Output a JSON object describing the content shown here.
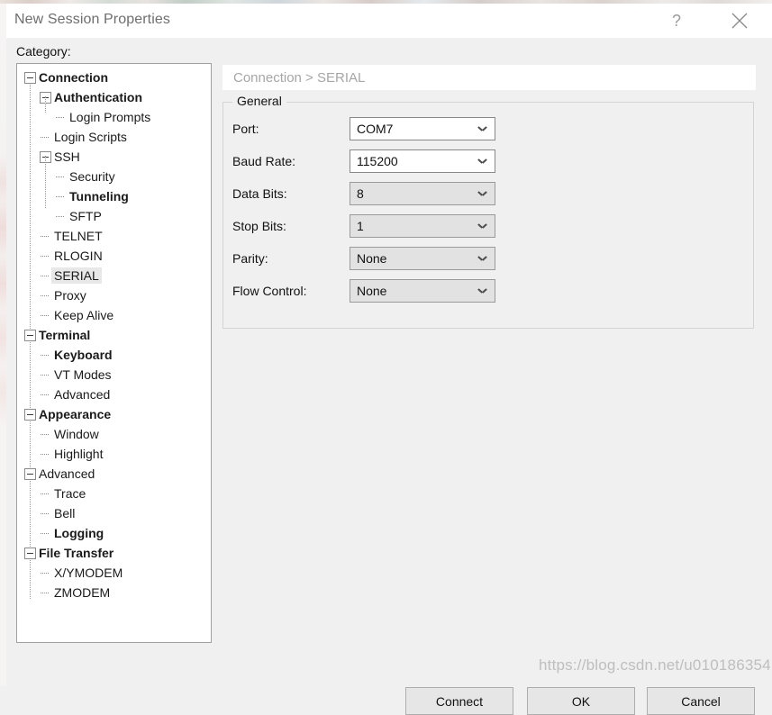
{
  "window": {
    "title": "New Session Properties",
    "help_icon": "question-mark-icon",
    "close_icon": "close-icon"
  },
  "sidebar": {
    "label": "Category:",
    "selected": "SERIAL",
    "items": [
      {
        "label": "Connection",
        "level": 0,
        "bold": true,
        "expander": "minus"
      },
      {
        "label": "Authentication",
        "level": 1,
        "bold": true,
        "expander": "minus"
      },
      {
        "label": "Login Prompts",
        "level": 2,
        "bold": false,
        "expander": "leaf-last"
      },
      {
        "label": "Login Scripts",
        "level": 1,
        "bold": false,
        "expander": "leaf"
      },
      {
        "label": "SSH",
        "level": 1,
        "bold": false,
        "expander": "minus"
      },
      {
        "label": "Security",
        "level": 2,
        "bold": false,
        "expander": "leaf"
      },
      {
        "label": "Tunneling",
        "level": 2,
        "bold": true,
        "expander": "leaf"
      },
      {
        "label": "SFTP",
        "level": 2,
        "bold": false,
        "expander": "leaf-last"
      },
      {
        "label": "TELNET",
        "level": 1,
        "bold": false,
        "expander": "leaf"
      },
      {
        "label": "RLOGIN",
        "level": 1,
        "bold": false,
        "expander": "leaf"
      },
      {
        "label": "SERIAL",
        "level": 1,
        "bold": false,
        "expander": "leaf"
      },
      {
        "label": "Proxy",
        "level": 1,
        "bold": false,
        "expander": "leaf"
      },
      {
        "label": "Keep Alive",
        "level": 1,
        "bold": false,
        "expander": "leaf-last"
      },
      {
        "label": "Terminal",
        "level": 0,
        "bold": true,
        "expander": "minus"
      },
      {
        "label": "Keyboard",
        "level": 1,
        "bold": true,
        "expander": "leaf"
      },
      {
        "label": "VT Modes",
        "level": 1,
        "bold": false,
        "expander": "leaf"
      },
      {
        "label": "Advanced",
        "level": 1,
        "bold": false,
        "expander": "leaf-last"
      },
      {
        "label": "Appearance",
        "level": 0,
        "bold": true,
        "expander": "minus"
      },
      {
        "label": "Window",
        "level": 1,
        "bold": false,
        "expander": "leaf"
      },
      {
        "label": "Highlight",
        "level": 1,
        "bold": false,
        "expander": "leaf-last"
      },
      {
        "label": "Advanced",
        "level": 0,
        "bold": false,
        "expander": "minus"
      },
      {
        "label": "Trace",
        "level": 1,
        "bold": false,
        "expander": "leaf"
      },
      {
        "label": "Bell",
        "level": 1,
        "bold": false,
        "expander": "leaf"
      },
      {
        "label": "Logging",
        "level": 1,
        "bold": true,
        "expander": "leaf-last"
      },
      {
        "label": "File Transfer",
        "level": 0,
        "bold": true,
        "expander": "minus"
      },
      {
        "label": "X/YMODEM",
        "level": 1,
        "bold": false,
        "expander": "leaf"
      },
      {
        "label": "ZMODEM",
        "level": 1,
        "bold": false,
        "expander": "leaf-last"
      }
    ]
  },
  "main": {
    "breadcrumb": "Connection > SERIAL",
    "group_title": "General",
    "fields": [
      {
        "label": "Port:",
        "value": "COM7",
        "disabled": false
      },
      {
        "label": "Baud Rate:",
        "value": "115200",
        "disabled": false
      },
      {
        "label": "Data Bits:",
        "value": "8",
        "disabled": true
      },
      {
        "label": "Stop Bits:",
        "value": "1",
        "disabled": true
      },
      {
        "label": "Parity:",
        "value": "None",
        "disabled": true
      },
      {
        "label": "Flow Control:",
        "value": "None",
        "disabled": true
      }
    ]
  },
  "footer": {
    "connect_label": "Connect",
    "ok_label": "OK",
    "cancel_label": "Cancel"
  },
  "watermark": {
    "text": "https://blog.csdn.net/u010186354"
  }
}
